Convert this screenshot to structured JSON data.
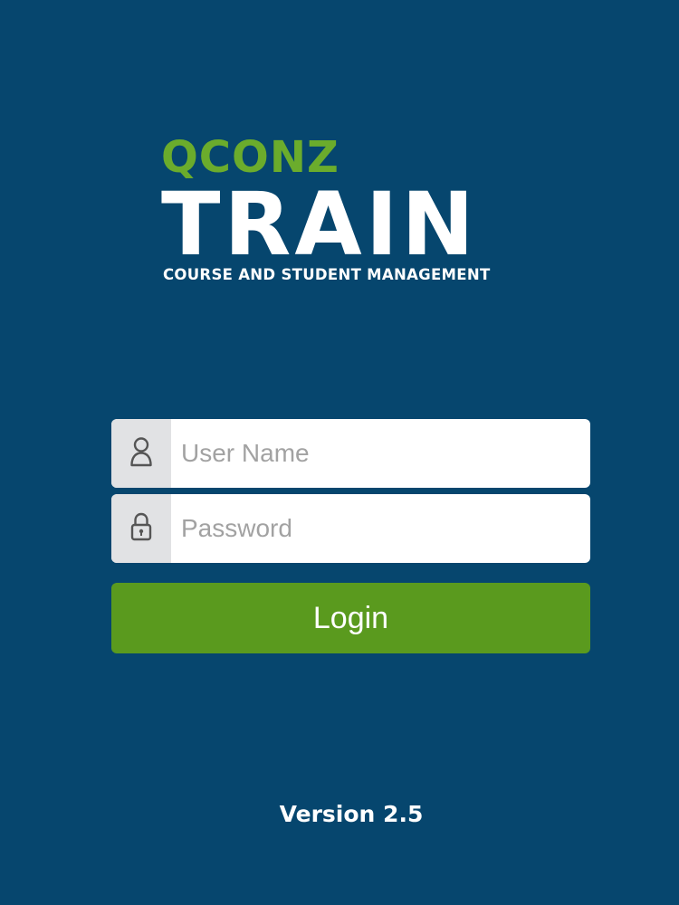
{
  "brand": {
    "line1": "QCONZ",
    "line2": "TRAIN",
    "tagline": "COURSE AND STUDENT MANAGEMENT",
    "accent_color": "#6bac2c"
  },
  "login_form": {
    "username": {
      "placeholder": "User Name",
      "value": "",
      "icon": "user-icon"
    },
    "password": {
      "placeholder": "Password",
      "value": "",
      "icon": "lock-icon"
    },
    "submit_label": "Login",
    "submit_color": "#5a9a1e"
  },
  "footer": {
    "version": "Version 2.5"
  },
  "colors": {
    "background": "#06466e",
    "input_addon": "#e1e2e4"
  }
}
